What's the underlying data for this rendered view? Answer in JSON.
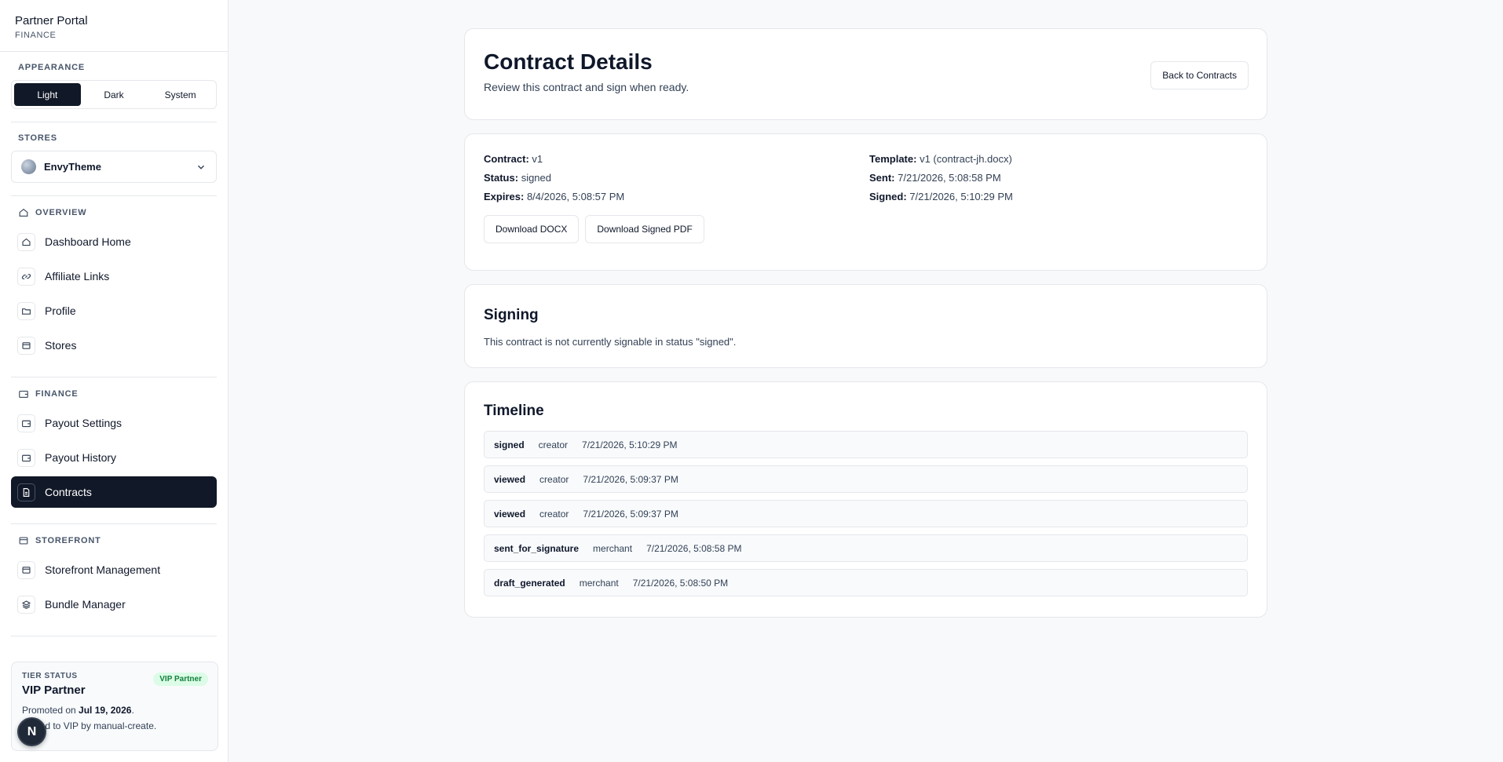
{
  "brand": {
    "title": "Partner Portal",
    "subtitle": "FINANCE"
  },
  "appearance": {
    "label": "APPEARANCE",
    "options": [
      "Light",
      "Dark",
      "System"
    ],
    "selected": "Light"
  },
  "stores": {
    "label": "STORES",
    "selected": "EnvyTheme"
  },
  "nav": {
    "overview": {
      "label": "OVERVIEW",
      "items": [
        "Dashboard Home",
        "Affiliate Links",
        "Profile",
        "Stores"
      ]
    },
    "finance": {
      "label": "FINANCE",
      "items": [
        "Payout Settings",
        "Payout History",
        "Contracts"
      ]
    },
    "storefront": {
      "label": "STOREFRONT",
      "items": [
        "Storefront Management",
        "Bundle Manager"
      ]
    },
    "active": "Contracts"
  },
  "tier": {
    "label": "TIER STATUS",
    "badge": "VIP Partner",
    "title": "VIP Partner",
    "promoted_prefix": "Promoted on ",
    "promoted_date": "Jul 19, 2026",
    "promoted_suffix": ".",
    "note": "Moved to VIP by manual-create."
  },
  "fab_label": "N",
  "header": {
    "title": "Contract Details",
    "subtitle": "Review this contract and sign when ready.",
    "back_button": "Back to Contracts"
  },
  "contract": {
    "contract_label": "Contract:",
    "contract_value": "v1",
    "template_label": "Template:",
    "template_value": "v1 (contract-jh.docx)",
    "status_label": "Status:",
    "status_value": "signed",
    "sent_label": "Sent:",
    "sent_value": "7/21/2026, 5:08:58 PM",
    "expires_label": "Expires:",
    "expires_value": "8/4/2026, 5:08:57 PM",
    "signed_label": "Signed:",
    "signed_value": "7/21/2026, 5:10:29 PM",
    "download_docx": "Download DOCX",
    "download_pdf": "Download Signed PDF"
  },
  "signing": {
    "title": "Signing",
    "message": "This contract is not currently signable in status \"signed\"."
  },
  "timeline": {
    "title": "Timeline",
    "events": [
      {
        "event": "signed",
        "actor": "creator",
        "time": "7/21/2026, 5:10:29 PM"
      },
      {
        "event": "viewed",
        "actor": "creator",
        "time": "7/21/2026, 5:09:37 PM"
      },
      {
        "event": "viewed",
        "actor": "creator",
        "time": "7/21/2026, 5:09:37 PM"
      },
      {
        "event": "sent_for_signature",
        "actor": "merchant",
        "time": "7/21/2026, 5:08:58 PM"
      },
      {
        "event": "draft_generated",
        "actor": "merchant",
        "time": "7/21/2026, 5:08:50 PM"
      }
    ]
  },
  "colors": {
    "primary": "#111827",
    "badge_bg": "#dcfce7",
    "badge_text": "#15803d"
  }
}
